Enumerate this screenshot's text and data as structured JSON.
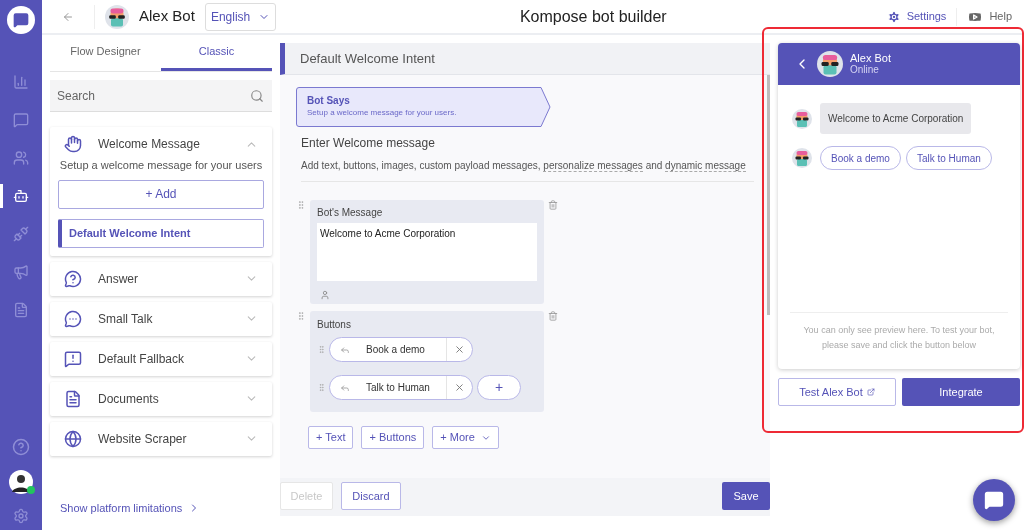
{
  "rail": {
    "items": [
      {
        "selected": false
      },
      {
        "selected": false
      },
      {
        "selected": false
      },
      {
        "selected": true
      },
      {
        "selected": false
      },
      {
        "selected": false
      },
      {
        "selected": false
      }
    ],
    "user_online": true
  },
  "topbar": {
    "bot_name": "Alex Bot",
    "language": "English",
    "title": "Kompose bot builder",
    "settings": "Settings",
    "help": "Help"
  },
  "sidebar": {
    "tabs": [
      {
        "label": "Flow Designer",
        "selected": false
      },
      {
        "label": "Classic",
        "selected": true
      }
    ],
    "search": {
      "placeholder": "Search"
    },
    "sections": [
      {
        "title": "Welcome Message",
        "expanded": true,
        "description": "Setup a welcome message for your users",
        "add_label": "+ Add",
        "intents": [
          {
            "label": "Default Welcome Intent",
            "selected": true
          }
        ]
      },
      {
        "title": "Answer",
        "expanded": false
      },
      {
        "title": "Small Talk",
        "expanded": false
      },
      {
        "title": "Default Fallback",
        "expanded": false
      },
      {
        "title": "Documents",
        "expanded": false
      },
      {
        "title": "Website Scraper",
        "expanded": false
      }
    ],
    "limitations_link": "Show platform limitations"
  },
  "editor": {
    "intent_title": "Default Welcome Intent",
    "step": {
      "title": "Bot Says",
      "subtitle": "Setup a welcome message for your users."
    },
    "heading": "Enter Welcome message",
    "description": [
      {
        "kind": "plain",
        "text": "Add text, buttons, images, custom payload messages, "
      },
      {
        "kind": "link",
        "text": "personalize messages"
      },
      {
        "kind": "plain",
        "text": " and "
      },
      {
        "kind": "link",
        "text": "dynamic message"
      }
    ],
    "message_block": {
      "label": "Bot's Message",
      "value": "Welcome to Acme Corporation"
    },
    "buttons_block": {
      "label": "Buttons",
      "buttons": [
        "Book a demo",
        "Talk to Human"
      ],
      "add": "+"
    },
    "add_actions": [
      {
        "label": "+ Text",
        "dropdown": false
      },
      {
        "label": "+ Buttons",
        "dropdown": false
      },
      {
        "label": "+ More",
        "dropdown": true
      }
    ],
    "footer": {
      "delete": {
        "label": "Delete",
        "disabled": true
      },
      "discard": "Discard",
      "save": "Save"
    }
  },
  "preview": {
    "name": "Alex Bot",
    "status": "Online",
    "message": "Welcome to Acme Corporation",
    "quick_replies": [
      "Book a demo",
      "Talk to Human"
    ],
    "note": "You can only see preview here. To test your bot, please save and click the button below",
    "test_button": "Test Alex Bot",
    "integrate_button": "Integrate"
  }
}
